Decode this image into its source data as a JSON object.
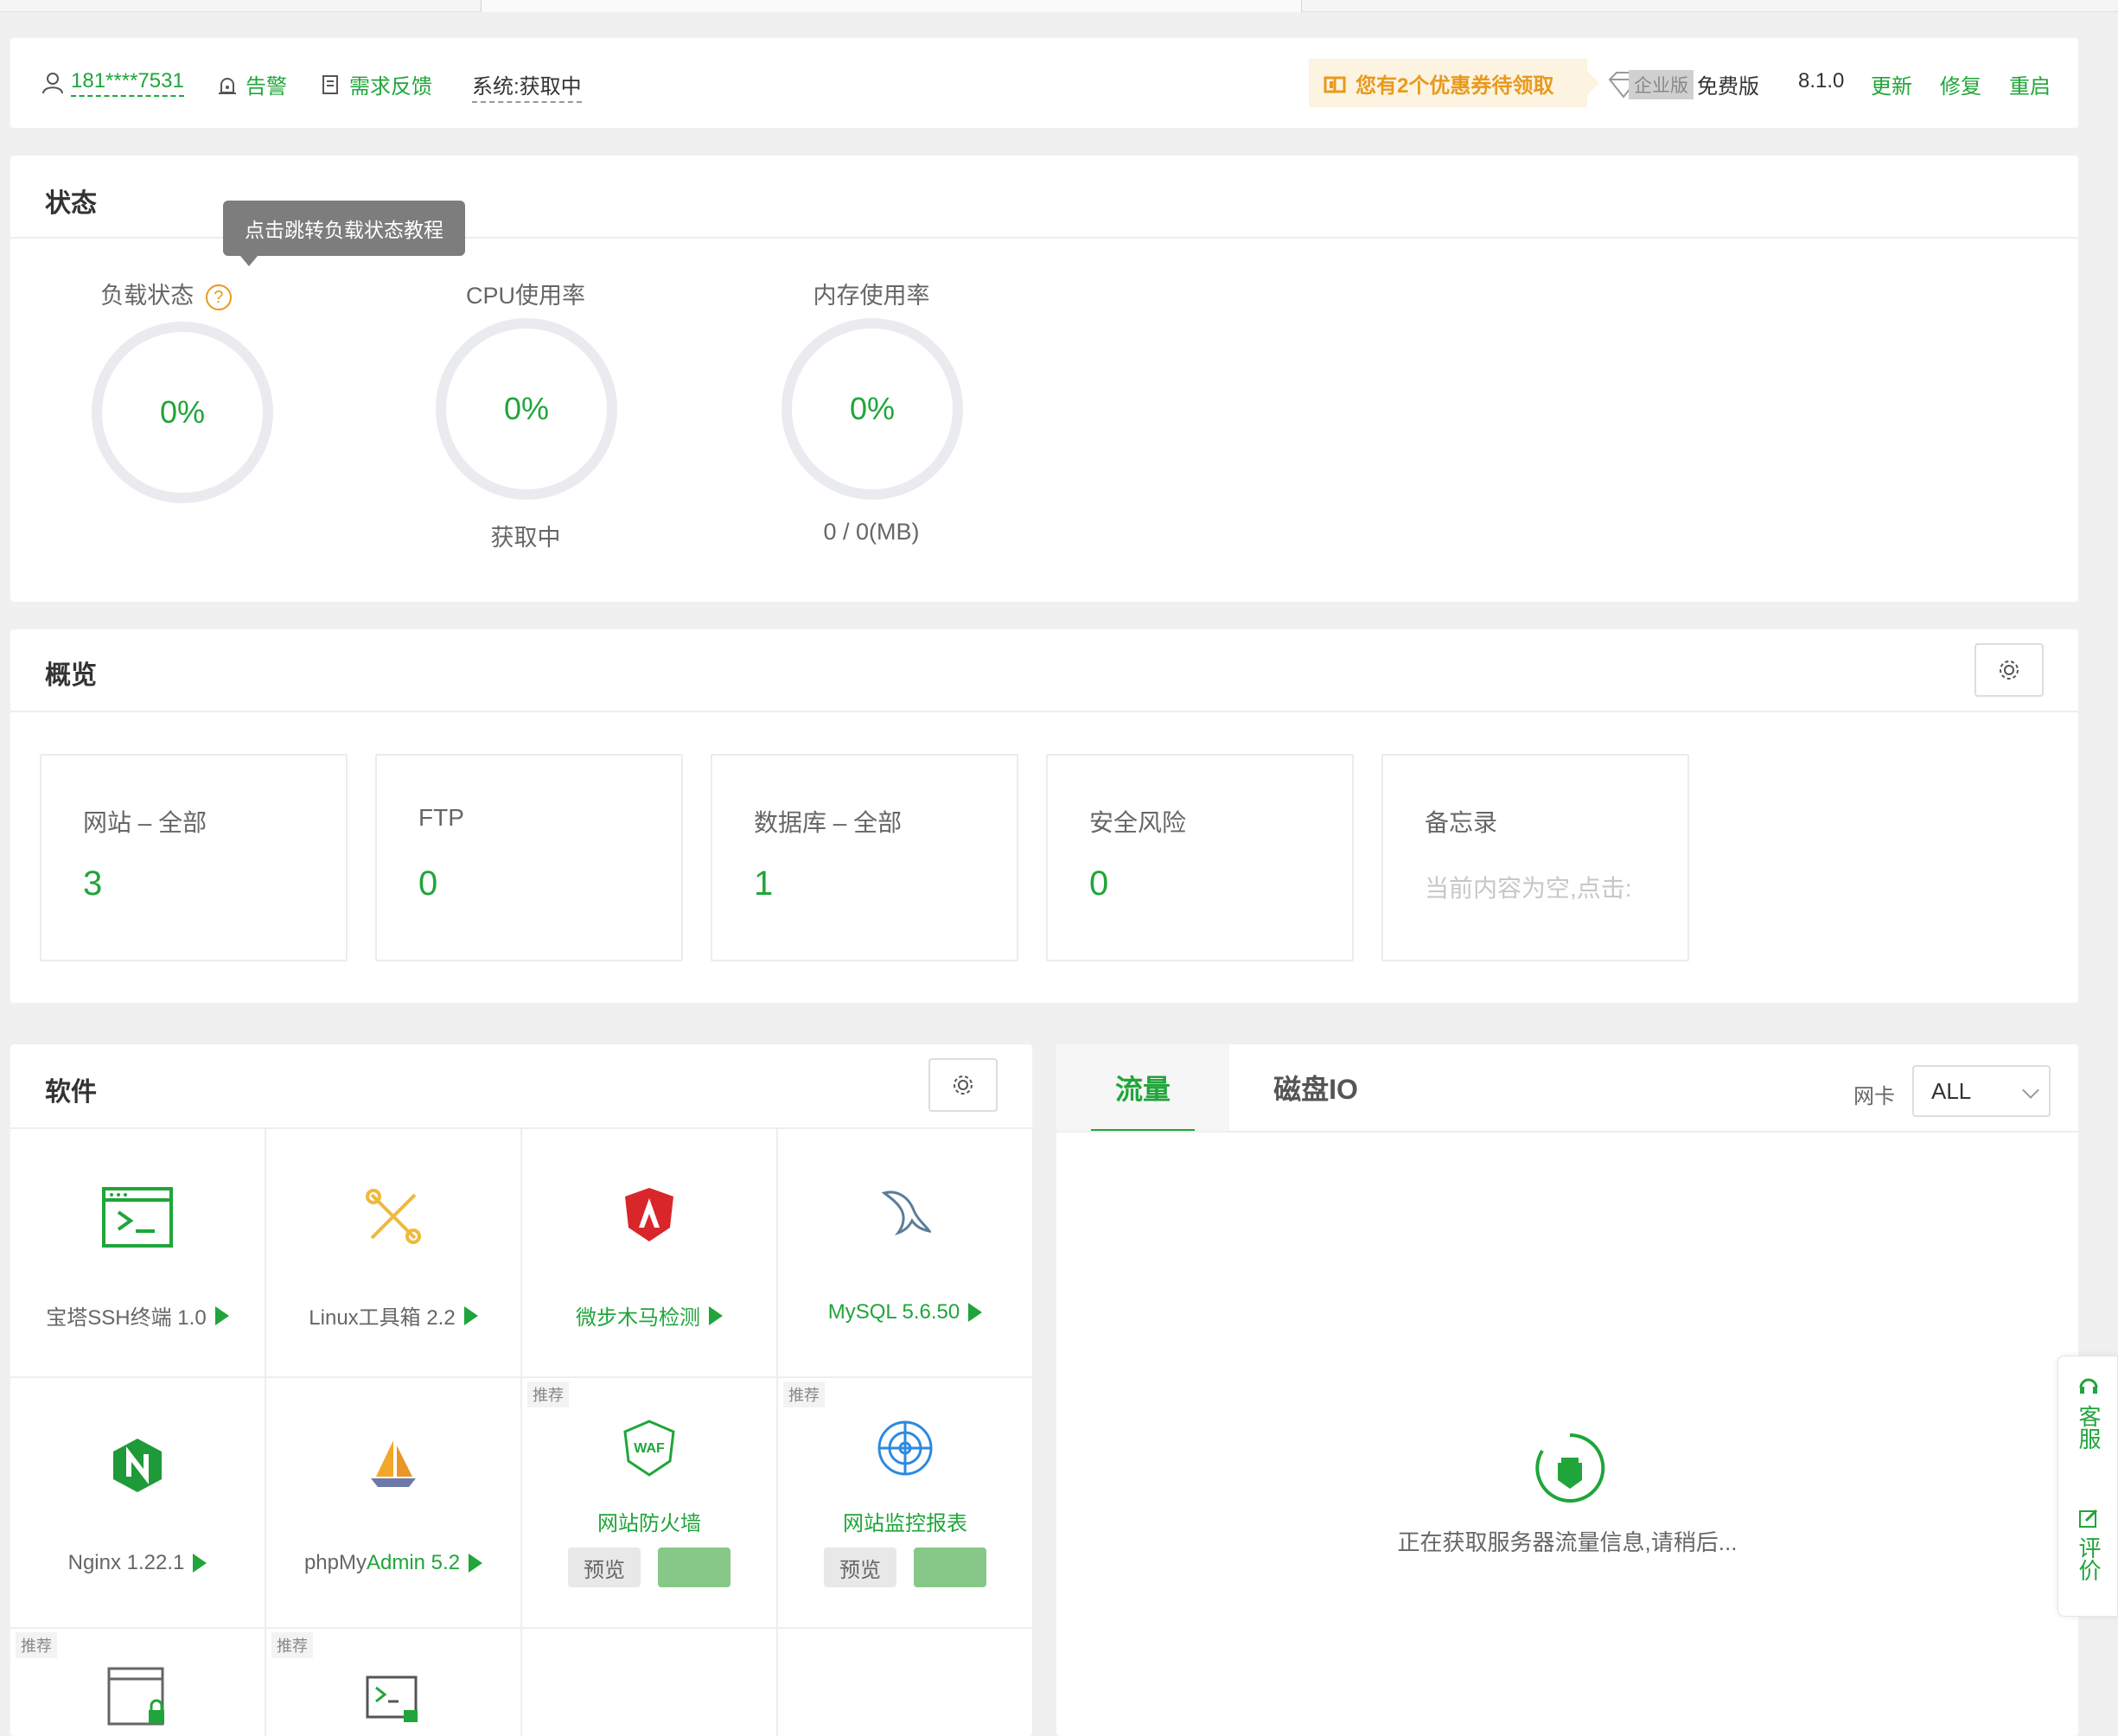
{
  "header": {
    "user": "181****7531",
    "alert": "告警",
    "feedback": "需求反馈",
    "system_label": "系统:",
    "system_value": "获取中",
    "coupon": "您有2个优惠券待领取",
    "edition_badge": "企业版",
    "edition": "免费版",
    "version": "8.1.0",
    "update": "更新",
    "repair": "修复",
    "restart": "重启"
  },
  "status": {
    "title": "状态",
    "tooltip": "点击跳转负载状态教程",
    "gauges": [
      {
        "label": "负载状态",
        "value": "0%",
        "sub": ""
      },
      {
        "label": "CPU使用率",
        "value": "0%",
        "sub": "获取中"
      },
      {
        "label": "内存使用率",
        "value": "0%",
        "sub": "0 / 0(MB)"
      }
    ]
  },
  "overview": {
    "title": "概览",
    "cards": [
      {
        "label": "网站 – 全部",
        "value": "3"
      },
      {
        "label": "FTP",
        "value": "0"
      },
      {
        "label": "数据库 – 全部",
        "value": "1"
      },
      {
        "label": "安全风险",
        "value": "0"
      },
      {
        "label": "备忘录",
        "placeholder": "当前内容为空,点击:"
      }
    ]
  },
  "software": {
    "title": "软件",
    "items": [
      {
        "name": "宝塔SSH终端 1.0",
        "icon": "terminal-icon"
      },
      {
        "name": "Linux工具箱 2.2",
        "icon": "tools-icon"
      },
      {
        "name": "微步木马检测",
        "icon": "shield-icon"
      },
      {
        "name": "MySQL 5.6.50",
        "icon": "mysql-dolphin-icon"
      },
      {
        "name": "Nginx 1.22.1",
        "icon": "nginx-icon"
      },
      {
        "name_a": "phpMy",
        "name_b": "Admin 5.2",
        "icon": "phpmyadmin-icon"
      },
      {
        "name": "网站防火墙",
        "tag": "推荐",
        "preview": "预览",
        "icon": "waf-icon"
      },
      {
        "name": "网站监控报表",
        "tag": "推荐",
        "preview": "预览",
        "icon": "monitor-target-icon"
      }
    ],
    "row3_tags": [
      "推荐",
      "推荐"
    ]
  },
  "traffic": {
    "tabs": [
      "流量",
      "磁盘IO"
    ],
    "nic_label": "网卡",
    "nic_value": "ALL",
    "loading": "正在获取服务器流量信息,请稍后..."
  },
  "float": {
    "service": "客服",
    "review": "评价"
  },
  "colors": {
    "accent": "#20a53a",
    "coupon": "#e89a1c"
  }
}
